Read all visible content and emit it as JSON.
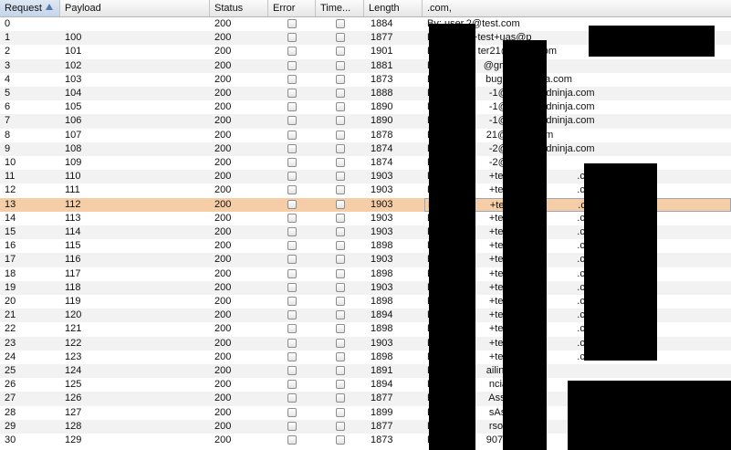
{
  "columns": {
    "request": "Request",
    "payload": "Payload",
    "status": "Status",
    "error": "Error",
    "timeout": "Time...",
    "length": "Length",
    "response": ".com,"
  },
  "selected_row": 13,
  "colors": {
    "selected_row": "#f5cda7",
    "alt_row": "#f2f2f2",
    "header": "#e6e6e6",
    "redaction": "#000000"
  },
  "rows": [
    {
      "request": "0",
      "payload": "",
      "status": "200",
      "length": "1884",
      "response": "By: user.2@test.com"
    },
    {
      "request": "1",
      "payload": "100",
      "status": "200",
      "length": "1877",
      "response": "By: testqa+test+uas@p"
    },
    {
      "request": "2",
      "payload": "101",
      "status": "200",
      "length": "1901",
      "response": "By: bo        ter21@gmail.com"
    },
    {
      "request": "3",
      "payload": "102",
      "status": "200",
      "length": "1881",
      "response": "By: fa           @gmail.com"
    },
    {
      "request": "4",
      "payload": "103",
      "status": "200",
      "length": "1873",
      "response": "By: iq            bugcrowdninja.com"
    },
    {
      "request": "5",
      "payload": "104",
      "status": "200",
      "length": "1888",
      "response": "By: ha            -1@bugcrowdninja.com"
    },
    {
      "request": "6",
      "payload": "105",
      "status": "200",
      "length": "1890",
      "response": "By: ha            -1@bugcrowdninja.com"
    },
    {
      "request": "7",
      "payload": "106",
      "status": "200",
      "length": "1890",
      "response": "By: ha            -1@bugcrowdninja.com"
    },
    {
      "request": "8",
      "payload": "107",
      "status": "200",
      "length": "1878",
      "response": "By: th            21@gmail.com"
    },
    {
      "request": "9",
      "payload": "108",
      "status": "200",
      "length": "1874",
      "response": "By: ha            -2@bugcrowdninja.com"
    },
    {
      "request": "10",
      "payload": "109",
      "status": "200",
      "length": "1874",
      "response": "By: ha            -2@bug"
    },
    {
      "request": "11",
      "payload": "110",
      "status": "200",
      "length": "1903",
      "response": "By: m             +test@                    .com"
    },
    {
      "request": "12",
      "payload": "111",
      "status": "200",
      "length": "1903",
      "response": "By: m             +test@                    .com"
    },
    {
      "request": "13",
      "payload": "112",
      "status": "200",
      "length": "1903",
      "response": "By: m             +test@                    .com"
    },
    {
      "request": "14",
      "payload": "113",
      "status": "200",
      "length": "1903",
      "response": "By: m             +test@                    .com"
    },
    {
      "request": "15",
      "payload": "114",
      "status": "200",
      "length": "1903",
      "response": "By: m             +test@                    .com"
    },
    {
      "request": "16",
      "payload": "115",
      "status": "200",
      "length": "1898",
      "response": "By: m             +test@                    .com"
    },
    {
      "request": "17",
      "payload": "116",
      "status": "200",
      "length": "1903",
      "response": "By: m             +test@                    .com"
    },
    {
      "request": "18",
      "payload": "117",
      "status": "200",
      "length": "1898",
      "response": "By: m             +test@                    .com"
    },
    {
      "request": "19",
      "payload": "118",
      "status": "200",
      "length": "1903",
      "response": "By: m             +test@                    .com"
    },
    {
      "request": "20",
      "payload": "119",
      "status": "200",
      "length": "1898",
      "response": "By: m             +test@                    .com"
    },
    {
      "request": "21",
      "payload": "120",
      "status": "200",
      "length": "1894",
      "response": "By: m             +test@                    .com"
    },
    {
      "request": "22",
      "payload": "121",
      "status": "200",
      "length": "1898",
      "response": "By: m             +test@                    .com"
    },
    {
      "request": "23",
      "payload": "122",
      "status": "200",
      "length": "1903",
      "response": "By: m             +test@                    .com"
    },
    {
      "request": "24",
      "payload": "123",
      "status": "200",
      "length": "1898",
      "response": "By: m             +test@                    .com"
    },
    {
      "request": "25",
      "payload": "124",
      "status": "200",
      "length": "1891",
      "response": "By: te            ailinator.com"
    },
    {
      "request": "26",
      "payload": "125",
      "status": "200",
      "length": "1894",
      "response": "By: qa            ncialA"
    },
    {
      "request": "27",
      "payload": "126",
      "status": "200",
      "length": "1877",
      "response": "By: qa            Associ"
    },
    {
      "request": "28",
      "payload": "127",
      "status": "200",
      "length": "1899",
      "response": "By: qa            sAsso"
    },
    {
      "request": "29",
      "payload": "128",
      "status": "200",
      "length": "1877",
      "response": "By: qa            rsonal"
    },
    {
      "request": "30",
      "payload": "129",
      "status": "200",
      "length": "1873",
      "response": "By: cr            907@"
    }
  ]
}
